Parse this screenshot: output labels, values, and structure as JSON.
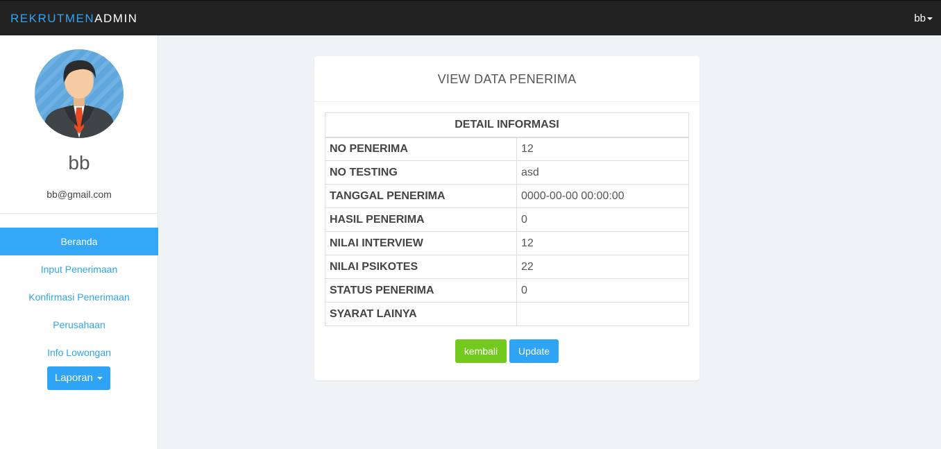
{
  "navbar": {
    "brand_part1": "REKRUTMEN",
    "brand_part2": "ADMIN",
    "user_label": "bb"
  },
  "sidebar": {
    "profile_name": "bb",
    "profile_email": "bb@gmail.com",
    "menu": [
      {
        "label": "Beranda"
      },
      {
        "label": "Input Penerimaan"
      },
      {
        "label": "Konfirmasi Penerimaan"
      },
      {
        "label": "Perusahaan"
      },
      {
        "label": "Info Lowongan"
      }
    ],
    "laporan_label": "Laporan"
  },
  "panel": {
    "title": "VIEW DATA PENERIMA",
    "table_header": "DETAIL INFORMASI",
    "rows": [
      {
        "label": "NO PENERIMA",
        "value": "12"
      },
      {
        "label": "NO TESTING",
        "value": "asd"
      },
      {
        "label": "TANGGAL PENERIMA",
        "value": "0000-00-00 00:00:00"
      },
      {
        "label": "HASIL PENERIMA",
        "value": "0"
      },
      {
        "label": "NILAI INTERVIEW",
        "value": "12"
      },
      {
        "label": "NILAI PSIKOTES",
        "value": "22"
      },
      {
        "label": "STATUS PENERIMA",
        "value": "0"
      },
      {
        "label": "SYARAT LAINYA",
        "value": ""
      }
    ],
    "kembali_label": "kembali",
    "update_label": "Update"
  },
  "colors": {
    "navbar_bg": "#222222",
    "brand_accent": "#2fa4f5",
    "primary": "#2fa4f5",
    "success": "#73c91e"
  },
  "icons": {
    "avatar": "businessman-avatar-icon",
    "dropdown": "caret-down-icon"
  }
}
